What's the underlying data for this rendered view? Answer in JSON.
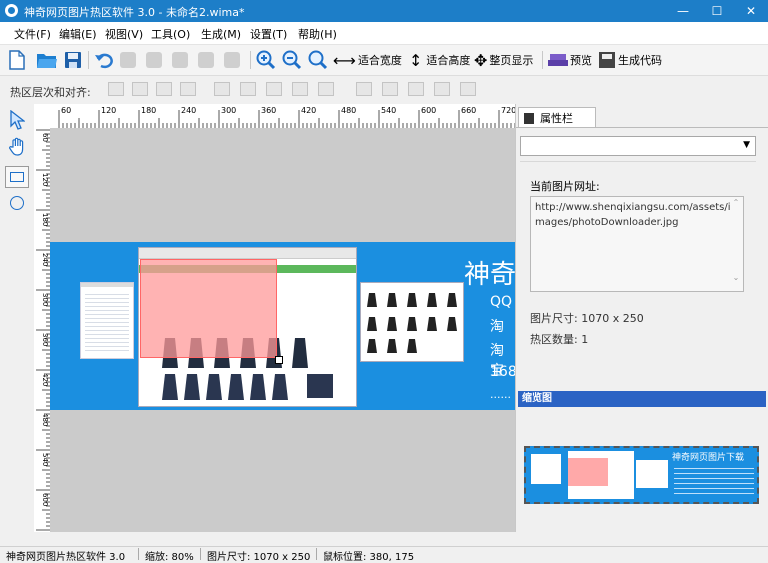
{
  "titlebar": {
    "title": "神奇网页图片热区软件 3.0 - 未命名2.wima*",
    "minimize": "—",
    "maximize": "☐",
    "close": "✕"
  },
  "menu": [
    "文件(F)",
    "编辑(E)",
    "视图(V)",
    "工具(O)",
    "生成(M)",
    "设置(T)",
    "帮助(H)"
  ],
  "toolbar": {
    "fit_width": "适合宽度",
    "fit_height": "适合高度",
    "full_page": "整页显示",
    "preview": "预览",
    "generate_code": "生成代码"
  },
  "alignbar": {
    "label": "热区层次和对齐:"
  },
  "ruler": {
    "top": [
      "60",
      "120",
      "180",
      "240",
      "300",
      "360",
      "420",
      "480",
      "540",
      "600",
      "660",
      "720"
    ],
    "left": [
      "60",
      "120",
      "180",
      "240",
      "300",
      "360",
      "420",
      "480",
      "540",
      "600",
      "660",
      "720",
      "780",
      "840",
      "900"
    ]
  },
  "canvas_image": {
    "title_text": "神奇",
    "lines": [
      "QQ",
      "淘",
      "淘宝",
      "168",
      "......"
    ]
  },
  "properties": {
    "tab": "属性栏",
    "url_label": "当前图片网址:",
    "url_value": "http://www.shenqixiangsu.com/assets/images/photoDownloader.jpg",
    "size_label": "图片尺寸: 1070 x 250",
    "count_label": "热区数量: 1",
    "thumb_header": "缩览图",
    "thumb_title": "神奇网页图片下载"
  },
  "status": {
    "app": "神奇网页图片热区软件 3.0",
    "zoom": "缩放: 80%",
    "size": "图片尺寸: 1070 x 250",
    "pos": "鼠标位置: 380, 175"
  },
  "colors": {
    "titlebar": "#1d7ec8",
    "image_bg": "#1b8fe0",
    "hotspot": "#ff9a9a",
    "thumb_header": "#2b63c4"
  }
}
